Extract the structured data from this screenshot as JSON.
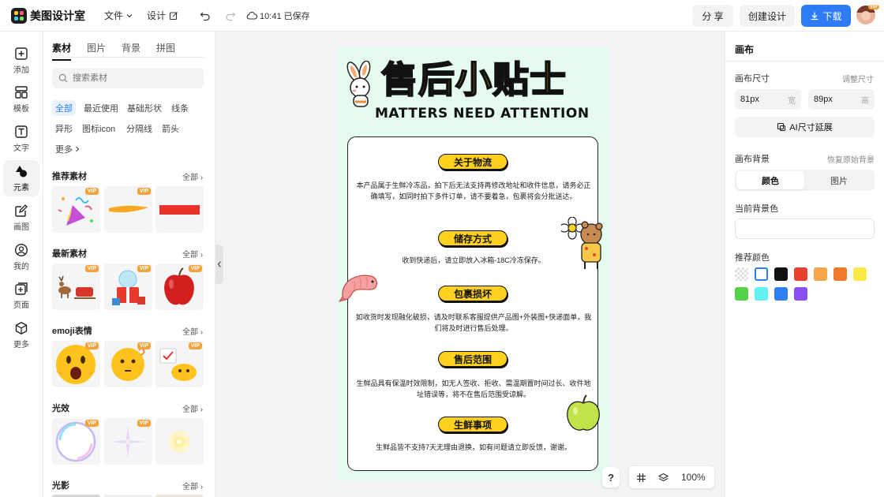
{
  "topbar": {
    "app_name": "美图设计室",
    "file_menu": "文件",
    "design_menu": "设计",
    "save_status": "10:41 已保存",
    "share": "分 享",
    "create": "创建设计",
    "download": "下载"
  },
  "sidebar": {
    "items": [
      {
        "label": "添加",
        "icon": "plus-icon"
      },
      {
        "label": "模板",
        "icon": "template-icon"
      },
      {
        "label": "文字",
        "icon": "text-icon"
      },
      {
        "label": "元素",
        "icon": "shapes-icon"
      },
      {
        "label": "画图",
        "icon": "draw-icon"
      },
      {
        "label": "我的",
        "icon": "user-icon"
      },
      {
        "label": "页面",
        "icon": "page-add-icon"
      },
      {
        "label": "更多",
        "icon": "cube-icon"
      }
    ],
    "active": "元素"
  },
  "panel": {
    "tabs": [
      "素材",
      "图片",
      "背景",
      "拼图"
    ],
    "search_placeholder": "搜索素材",
    "chips": [
      "全部",
      "最近使用",
      "基础形状",
      "线条",
      "异形",
      "图标icon",
      "分隔线",
      "箭头",
      "更多"
    ],
    "sections": [
      {
        "title": "推荐素材",
        "all": "全部"
      },
      {
        "title": "最新素材",
        "all": "全部"
      },
      {
        "title": "emoji表情",
        "all": "全部"
      },
      {
        "title": "光效",
        "all": "全部"
      },
      {
        "title": "光影",
        "all": "全部"
      }
    ],
    "vip": "VIP"
  },
  "poster": {
    "title": "售后小贴士",
    "subtitle": "MATTERS NEED ATTENTION",
    "sections": [
      {
        "heading": "关于物流",
        "text": "本产品属于生鲜冷冻品，拍下后无法支持再修改地址和收件信息，请务必正确填写，如同时拍下多件订单，请不要着急，包裹将会分批送达。"
      },
      {
        "heading": "储存方式",
        "text": "收到快递后，请立即放入冰箱-18C冷冻保存。"
      },
      {
        "heading": "包裹损坏",
        "text": "如收货时发现融化破损，请及时联系客服提供产品图+外装图+快递面单，我们将及时进行售后处理。"
      },
      {
        "heading": "售后范围",
        "text": "生鲜品具有保温时效限制，如无人签收、拒收、需温期置时间过长、收件地址错误等，将不在售后范围受谅解。"
      },
      {
        "heading": "生鲜事项",
        "text": "生鲜品皆不支持7天无理由退换，如有问题请立即反馈，谢谢。"
      }
    ]
  },
  "canvas_tools": {
    "help": "?",
    "zoom": "100%"
  },
  "props": {
    "title": "画布",
    "size_label": "画布尺寸",
    "adjust_size": "调整尺寸",
    "width_value": "81px",
    "width_unit": "宽",
    "height_value": "89px",
    "height_unit": "高",
    "ai_extend": "AI尺寸延展",
    "bg_label": "画布背景",
    "restore_bg": "恢复原始背景",
    "seg_color": "颜色",
    "seg_image": "图片",
    "current_bg": "当前背景色",
    "recommended": "推荐颜色",
    "colors": [
      "transparent",
      "#ffffff",
      "#111111",
      "#e8402f",
      "#f6a54a",
      "#f07a2a",
      "#fbe94a",
      "#55d24a",
      "#64f0f0",
      "#2f7ff0",
      "#8a4ff0"
    ]
  }
}
